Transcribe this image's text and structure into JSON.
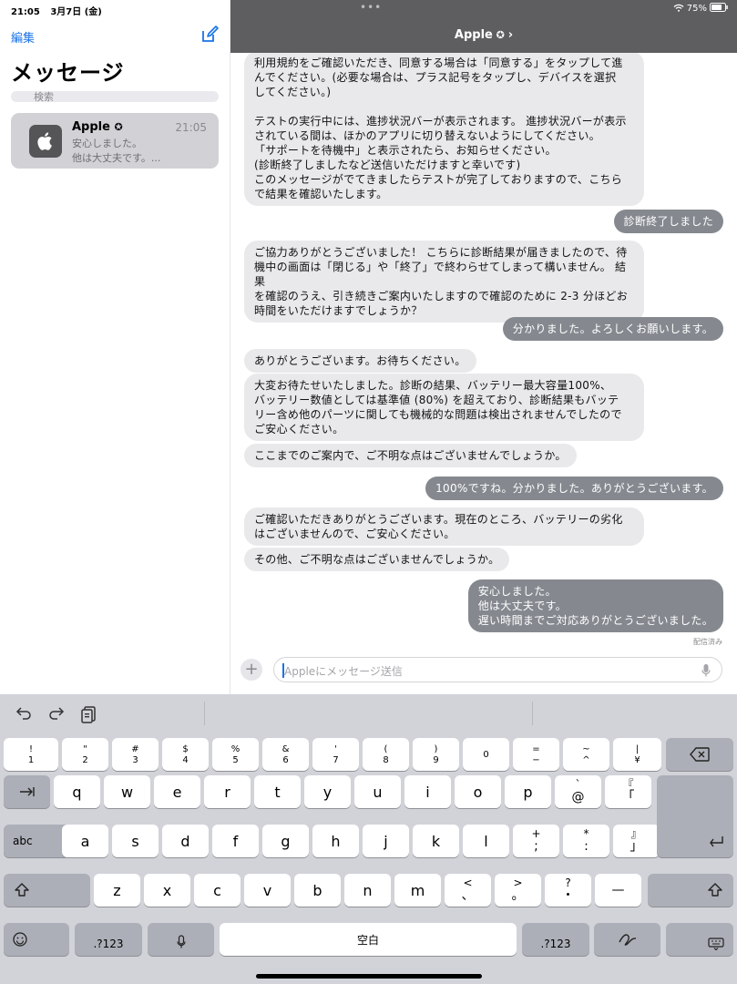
{
  "status": {
    "time": "21:05",
    "date": "3月7日 (金)",
    "battery": "75%"
  },
  "sidebar": {
    "edit": "編集",
    "title": "メッセージ",
    "search_placeholder": "検索",
    "conversation": {
      "name": "Apple",
      "time": "21:05",
      "preview_line1": "安心しました。",
      "preview_line2": "他は大丈夫です。..."
    }
  },
  "chat": {
    "header_title": "Apple",
    "messages": [
      {
        "dir": "in",
        "text": "利用規約をご確認いただき、同意する場合は「同意する」をタップして進\nんでください。(必要な場合は、プラス記号をタップし、デバイスを選択\nしてください。)\n\nテストの実行中には、進捗状況バーが表示されます。 進捗状況バーが表示\nされている間は、ほかのアプリに切り替えないようにしてください。\n「サポートを待機中」と表示されたら、お知らせください。\n(診断終了しましたなど送信いただけますと幸いです)\nこのメッセージがでてきましたらテストが完了しておりますので、こちら\nで結果を確認いたします。"
      },
      {
        "dir": "out",
        "text": "診断終了しました"
      },
      {
        "dir": "in",
        "text": "ご協力ありがとうございました！ こちらに診断結果が届きましたので、待\n機中の画面は「閉じる」や「終了」で終わらせてしまって構いません。 結果\nを確認のうえ、引き続きご案内いたしますので確認のために 2-3 分ほどお\n時間をいただけますでしょうか？"
      },
      {
        "dir": "out",
        "text": "分かりました。よろしくお願いします。"
      },
      {
        "dir": "in",
        "text": "ありがとうございます。お待ちください。"
      },
      {
        "dir": "in",
        "text": "大変お待たせいたしました。診断の結果、バッテリー最大容量100%、\nバッテリー数値としては基準値 (80%) を超えており、診断結果もバッテ\nリー含め他のパーツに関しても機械的な問題は検出されませんでしたので\nご安心ください。"
      },
      {
        "dir": "in",
        "text": "ここまでのご案内で、ご不明な点はございませんでしょうか。"
      },
      {
        "dir": "out",
        "text": "100%ですね。分かりました。ありがとうございます。"
      },
      {
        "dir": "in",
        "text": "ご確認いただきありがとうございます。現在のところ、バッテリーの劣化\nはございませんので、ご安心ください。"
      },
      {
        "dir": "in",
        "text": "その他、ご不明な点はございませんでしょうか。"
      },
      {
        "dir": "out",
        "text": "安心しました。\n他は大丈夫です。\n遅い時間までご対応ありがとうございました。"
      }
    ],
    "delivered": "配信済み",
    "input_placeholder": "Appleにメッセージ送信"
  },
  "keyboard": {
    "row_numbers": [
      {
        "top": "!",
        "bot": "1"
      },
      {
        "top": "\"",
        "bot": "2"
      },
      {
        "top": "#",
        "bot": "3"
      },
      {
        "top": "$",
        "bot": "4"
      },
      {
        "top": "%",
        "bot": "5"
      },
      {
        "top": "&",
        "bot": "6"
      },
      {
        "top": "'",
        "bot": "7"
      },
      {
        "top": "(",
        "bot": "8"
      },
      {
        "top": ")",
        "bot": "9"
      },
      {
        "top": "",
        "bot": "0"
      },
      {
        "top": "=",
        "bot": "−"
      },
      {
        "top": "~",
        "bot": "^"
      },
      {
        "top": "|",
        "bot": "¥"
      }
    ],
    "row_q": [
      "q",
      "w",
      "e",
      "r",
      "t",
      "y",
      "u",
      "i",
      "o",
      "p"
    ],
    "row_q_extra": [
      {
        "top": "`",
        "bot": "@"
      },
      {
        "top": "『",
        "bot": "「"
      }
    ],
    "row_a": [
      "a",
      "s",
      "d",
      "f",
      "g",
      "h",
      "j",
      "k",
      "l"
    ],
    "row_a_extra": [
      {
        "top": "+",
        "bot": ";"
      },
      {
        "top": "*",
        "bot": ":"
      },
      {
        "top": "』",
        "bot": "」"
      }
    ],
    "row_z": [
      "z",
      "x",
      "c",
      "v",
      "b",
      "n",
      "m"
    ],
    "row_z_extra": [
      {
        "top": "<",
        "bot": "、"
      },
      {
        "top": ">",
        "bot": "。"
      },
      {
        "top": "?",
        "bot": "・"
      },
      {
        "top": "",
        "bot": "—"
      }
    ],
    "abc_label": "abc",
    "num_label": ".?123",
    "space_label": "空白"
  }
}
